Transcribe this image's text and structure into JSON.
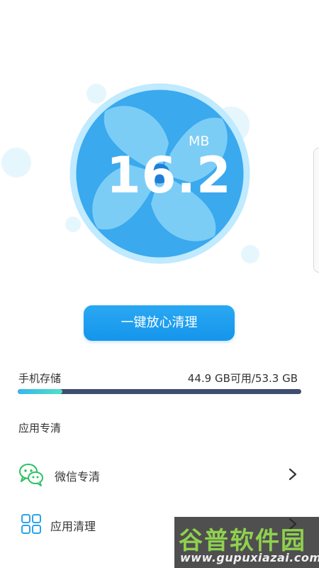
{
  "junk": {
    "value": "16.2",
    "unit": "MB"
  },
  "clean_button": {
    "label": "一键放心清理"
  },
  "storage": {
    "label": "手机存储",
    "value_text": "44.9 GB可用/53.3 GB",
    "used_fraction": 0.158
  },
  "section": {
    "title": "应用专清"
  },
  "items": [
    {
      "label": "微信专清",
      "icon": "wechat-icon"
    },
    {
      "label": "应用清理",
      "icon": "app-grid-icon"
    }
  ],
  "watermark": {
    "title": "谷普软件园",
    "url": "www.gupuxiazai.com"
  },
  "colors": {
    "accent": "#1595ec",
    "fan_blue": "#3aa9ee",
    "wechat_green": "#2bc261",
    "app_icon": "#2ea3ea",
    "bar_track": "#3e4e6e"
  }
}
